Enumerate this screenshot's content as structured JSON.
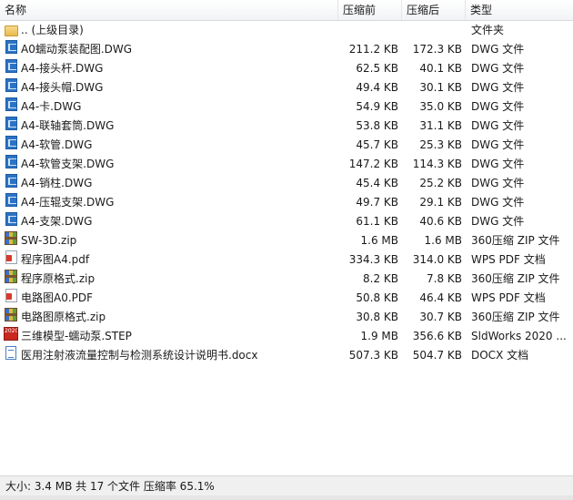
{
  "columns": {
    "name": "名称",
    "packed": "压缩前",
    "size": "压缩后",
    "type": "类型"
  },
  "files": [
    {
      "icon": "folder-icon",
      "name": ".. (上级目录)",
      "packed": "",
      "size": "",
      "type": "文件夹"
    },
    {
      "icon": "dwg-file-icon",
      "name": "A0蠕动泵装配图.DWG",
      "packed": "211.2 KB",
      "size": "172.3 KB",
      "type": "DWG 文件"
    },
    {
      "icon": "dwg-file-icon",
      "name": "A4-接头杆.DWG",
      "packed": "62.5 KB",
      "size": "40.1 KB",
      "type": "DWG 文件"
    },
    {
      "icon": "dwg-file-icon",
      "name": "A4-接头帽.DWG",
      "packed": "49.4 KB",
      "size": "30.1 KB",
      "type": "DWG 文件"
    },
    {
      "icon": "dwg-file-icon",
      "name": "A4-卡.DWG",
      "packed": "54.9 KB",
      "size": "35.0 KB",
      "type": "DWG 文件"
    },
    {
      "icon": "dwg-file-icon",
      "name": "A4-联轴套筒.DWG",
      "packed": "53.8 KB",
      "size": "31.1 KB",
      "type": "DWG 文件"
    },
    {
      "icon": "dwg-file-icon",
      "name": "A4-软管.DWG",
      "packed": "45.7 KB",
      "size": "25.3 KB",
      "type": "DWG 文件"
    },
    {
      "icon": "dwg-file-icon",
      "name": "A4-软管支架.DWG",
      "packed": "147.2 KB",
      "size": "114.3 KB",
      "type": "DWG 文件"
    },
    {
      "icon": "dwg-file-icon",
      "name": "A4-销柱.DWG",
      "packed": "45.4 KB",
      "size": "25.2 KB",
      "type": "DWG 文件"
    },
    {
      "icon": "dwg-file-icon",
      "name": "A4-压辊支架.DWG",
      "packed": "49.7 KB",
      "size": "29.1 KB",
      "type": "DWG 文件"
    },
    {
      "icon": "dwg-file-icon",
      "name": "A4-支架.DWG",
      "packed": "61.1 KB",
      "size": "40.6 KB",
      "type": "DWG 文件"
    },
    {
      "icon": "zip-file-icon",
      "name": "SW-3D.zip",
      "packed": "1.6 MB",
      "size": "1.6 MB",
      "type": "360压缩 ZIP 文件"
    },
    {
      "icon": "pdf-file-icon",
      "name": "程序图A4.pdf",
      "packed": "334.3 KB",
      "size": "314.0 KB",
      "type": "WPS PDF 文档"
    },
    {
      "icon": "zip-file-icon",
      "name": "程序原格式.zip",
      "packed": "8.2 KB",
      "size": "7.8 KB",
      "type": "360压缩 ZIP 文件"
    },
    {
      "icon": "pdf-file-icon",
      "name": "电路图A0.PDF",
      "packed": "50.8 KB",
      "size": "46.4 KB",
      "type": "WPS PDF 文档"
    },
    {
      "icon": "zip-file-icon",
      "name": "电路图原格式.zip",
      "packed": "30.8 KB",
      "size": "30.7 KB",
      "type": "360压缩 ZIP 文件"
    },
    {
      "icon": "step-file-icon",
      "name": "三维模型-蠕动泵.STEP",
      "packed": "1.9 MB",
      "size": "356.6 KB",
      "type": "SldWorks 2020 ..."
    },
    {
      "icon": "docx-file-icon",
      "name": "医用注射液流量控制与检测系统设计说明书.docx",
      "packed": "507.3 KB",
      "size": "504.7 KB",
      "type": "DOCX 文档"
    }
  ],
  "status": {
    "text": "大小: 3.4 MB 共 17 个文件 压缩率 65.1%"
  },
  "step_icon_label": "2020"
}
